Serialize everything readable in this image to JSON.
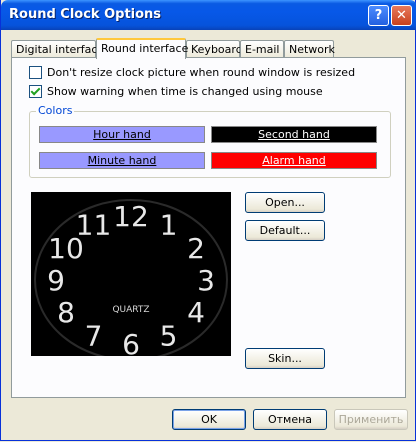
{
  "window": {
    "title": "Round Clock Options"
  },
  "tabs": [
    "Digital interface",
    "Round interface",
    "Keyboard",
    "E-mail",
    "Network"
  ],
  "options": {
    "no_resize": {
      "label": "Don't resize clock picture when round window is resized",
      "checked": false
    },
    "warn_time": {
      "label": "Show warning when time is changed using mouse",
      "checked": true
    }
  },
  "colors": {
    "group_label": "Colors",
    "hour_hand": {
      "label": "Hour hand",
      "bg": "#9999ff",
      "fg": "#000000"
    },
    "second_hand": {
      "label": "Second hand",
      "bg": "#000000",
      "fg": "#ffffff"
    },
    "minute_hand": {
      "label": "Minute hand",
      "bg": "#9999ff",
      "fg": "#000000"
    },
    "alarm_hand": {
      "label": "Alarm hand",
      "bg": "#ff0000",
      "fg": "#ffffff"
    }
  },
  "clock": {
    "brand": "QUARTZ",
    "numerals": [
      "12",
      "1",
      "2",
      "3",
      "4",
      "5",
      "6",
      "7",
      "8",
      "9",
      "10",
      "11"
    ]
  },
  "buttons": {
    "open": "Open...",
    "default": "Default...",
    "skin": "Skin...",
    "ok": "OK",
    "cancel": "Отмена",
    "apply": "Применить"
  }
}
